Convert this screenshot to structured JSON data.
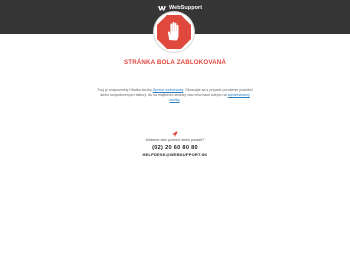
{
  "header": {
    "brand": "WebSupport",
    "logo_icon": "websupport-logo-icon",
    "bg_color": "#363636"
  },
  "emblem": {
    "icon": "stop-hand-icon",
    "color": "#e0473d"
  },
  "title": "STRÁNKA BOLA ZABLOKOVANÁ",
  "description": {
    "part1": "Tvoj je zodpovedný Hľadka služby ",
    "link1": "Správe webstránky",
    "part2": ". Obracajte sa s prípade porušenie pravidiel alebo neoprávnených faktúry. Ak sa majiteľom stránky viac informácií kdeyto na ",
    "link2": "administračný služby",
    "part3": "."
  },
  "help": {
    "icon": "rocket-icon",
    "question": "Môžeme vám pomôcť alebo poradiť?",
    "phone": "(02) 20 60 80 80",
    "email": "HELPDESK@WEBSUPPORT.SK"
  }
}
